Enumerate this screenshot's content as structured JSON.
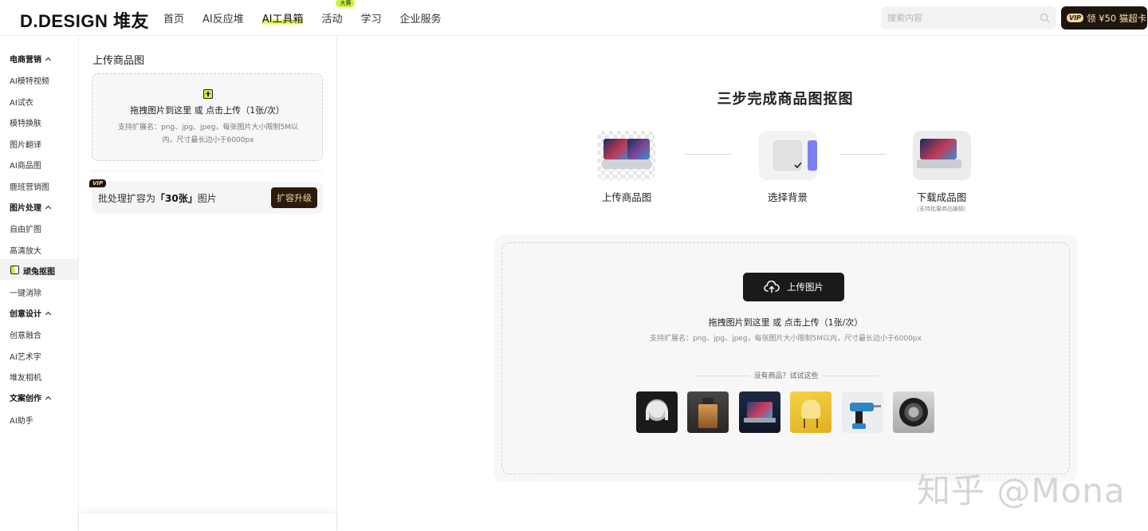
{
  "header": {
    "logo": "D.DESIGN 堆友",
    "nav": [
      {
        "label": "首页",
        "badge": ""
      },
      {
        "label": "AI反应堆",
        "badge": ""
      },
      {
        "label": "AI工具箱",
        "badge": ""
      },
      {
        "label": "活动",
        "badge": "大赛"
      },
      {
        "label": "学习",
        "badge": ""
      },
      {
        "label": "企业服务",
        "badge": ""
      }
    ],
    "search_placeholder": "搜索内容",
    "vip_tag": "VIP",
    "vip_label": "领 ¥50 猫超卡"
  },
  "sidebar": {
    "groups": [
      {
        "title": "电商营销",
        "items": [
          "AI模特视频",
          "AI试衣",
          "模特换肤",
          "图片翻译",
          "AI商品图",
          "鹿班营销图"
        ]
      },
      {
        "title": "图片处理",
        "items": [
          "自由扩图",
          "高清放大",
          "顽兔抠图",
          "一键消除"
        ]
      },
      {
        "title": "创意设计",
        "items": [
          "创意融合",
          "AI艺术字",
          "堆友相机"
        ]
      },
      {
        "title": "文案创作",
        "items": [
          "AI助手"
        ]
      }
    ],
    "active_item": "顽兔抠图"
  },
  "left_panel": {
    "title": "上传商品图",
    "drop_main": "拖拽图片到这里 或 点击上传（1张/次）",
    "drop_sub": "支持扩展名：png、jpg、jpeg，每张图片大小限制5M以内，尺寸最长边小于6000px",
    "vip_badge": "VIP",
    "batch_prefix": "批处理扩容为",
    "batch_count": "「30张」",
    "batch_suffix": "图片",
    "upgrade_label": "扩容升级"
  },
  "main": {
    "title": "三步完成商品图抠图",
    "steps": [
      {
        "label": "上传商品图",
        "note": ""
      },
      {
        "label": "选择背景",
        "note": ""
      },
      {
        "label": "下载成品图",
        "note": "（支持批量商品编辑）"
      }
    ],
    "upload_button": "上传图片",
    "upload_main": "拖拽图片到这里 或 点击上传（1张/次）",
    "upload_sub": "支持扩展名：png、jpg、jpeg，每张图片大小限制5M以内，尺寸最长边小于6000px",
    "try_text": "没有商品？试试这些",
    "samples": [
      "headphones-sample",
      "perfume-sample",
      "laptop-sample",
      "chair-sample",
      "drill-sample",
      "tire-sample"
    ]
  },
  "watermark": "知乎 @Mona",
  "colors": {
    "accent": "#c6f33d",
    "vip_dark": "#1e150c",
    "vip_gold": "#f2d6a2",
    "button_dark": "#1a1a1a"
  }
}
